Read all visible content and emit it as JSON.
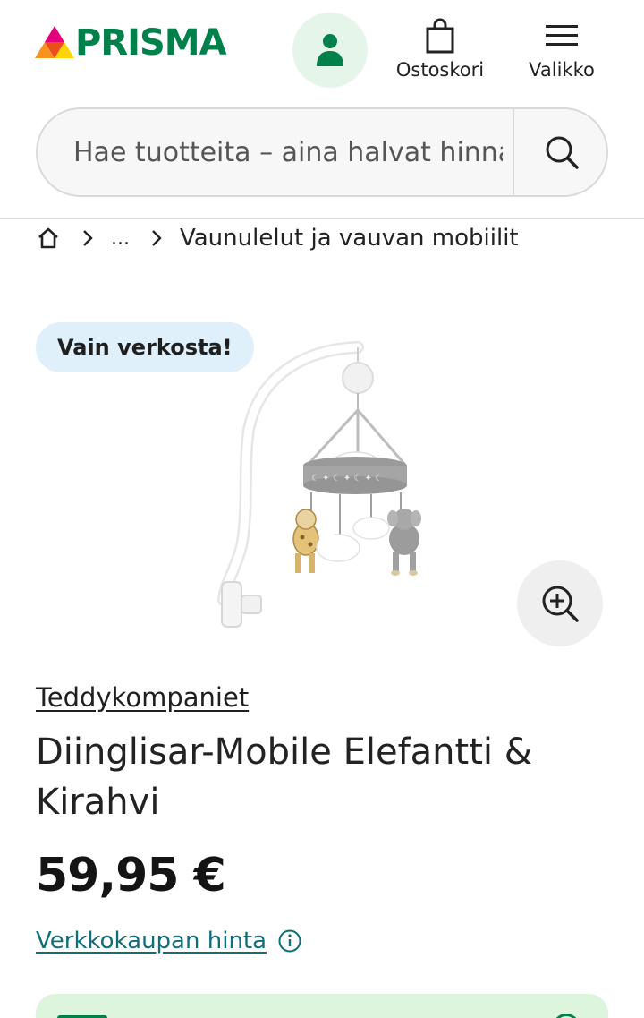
{
  "header": {
    "logo_text": "PRISMA",
    "account_icon": "user-icon",
    "cart_label": "Ostoskori",
    "menu_label": "Valikko",
    "brand_color": "#00804a"
  },
  "search": {
    "placeholder": "Hae tuotteita – aina halvat hinnat"
  },
  "breadcrumb": {
    "home_icon": "home-icon",
    "ellipsis": "...",
    "current": "Vaunulelut ja vauvan mobiilit"
  },
  "product": {
    "badge": "Vain verkosta!",
    "image_alt": "Diinglisar-Mobile Elefantti & Kirahvi",
    "brand": "Teddykompaniet",
    "title": "Diinglisar-Mobile Elefantti & Kirahvi",
    "price": "59,95 €",
    "price_note": "Verkkokaupan hinta"
  },
  "colors": {
    "badge_bg": "#dff0fb",
    "link": "#0f6e7a",
    "panel_bg": "#dcf5dc"
  }
}
